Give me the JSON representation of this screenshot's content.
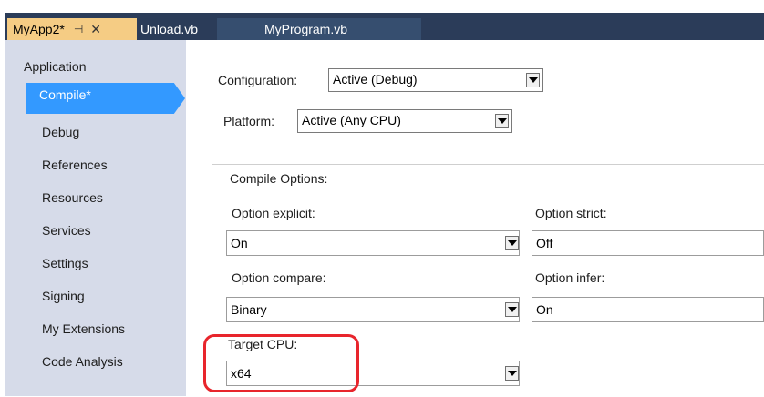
{
  "tabs": [
    {
      "label": "MyApp2*",
      "pin_icon": "pin-icon",
      "close_icon": "close-icon",
      "active": true
    },
    {
      "label": "Unload.vb",
      "active": false
    },
    {
      "label": "MyProgram.vb",
      "active": false
    }
  ],
  "sidebar": {
    "items": [
      {
        "label": "Application"
      },
      {
        "label": "Compile*",
        "selected": true
      },
      {
        "label": "Debug"
      },
      {
        "label": "References"
      },
      {
        "label": "Resources"
      },
      {
        "label": "Services"
      },
      {
        "label": "Settings"
      },
      {
        "label": "Signing"
      },
      {
        "label": "My Extensions"
      },
      {
        "label": "Code Analysis"
      }
    ]
  },
  "main": {
    "configuration": {
      "label": "Configuration:",
      "value": "Active (Debug)"
    },
    "platform": {
      "label": "Platform:",
      "value": "Active (Any CPU)"
    },
    "compile_options": {
      "title": "Compile Options:",
      "option_explicit": {
        "label": "Option explicit:",
        "value": "On"
      },
      "option_strict": {
        "label": "Option strict:",
        "value": "Off"
      },
      "option_compare": {
        "label": "Option compare:",
        "value": "Binary"
      },
      "option_infer": {
        "label": "Option infer:",
        "value": "On"
      },
      "target_cpu": {
        "label": "Target CPU:",
        "value": "x64"
      }
    }
  },
  "colors": {
    "tab_strip": "#2b3c59",
    "active_tab": "#f5cc84",
    "sidebar_bg": "#d6dbe9",
    "selected_nav": "#3399ff",
    "highlight": "#e8252c"
  }
}
